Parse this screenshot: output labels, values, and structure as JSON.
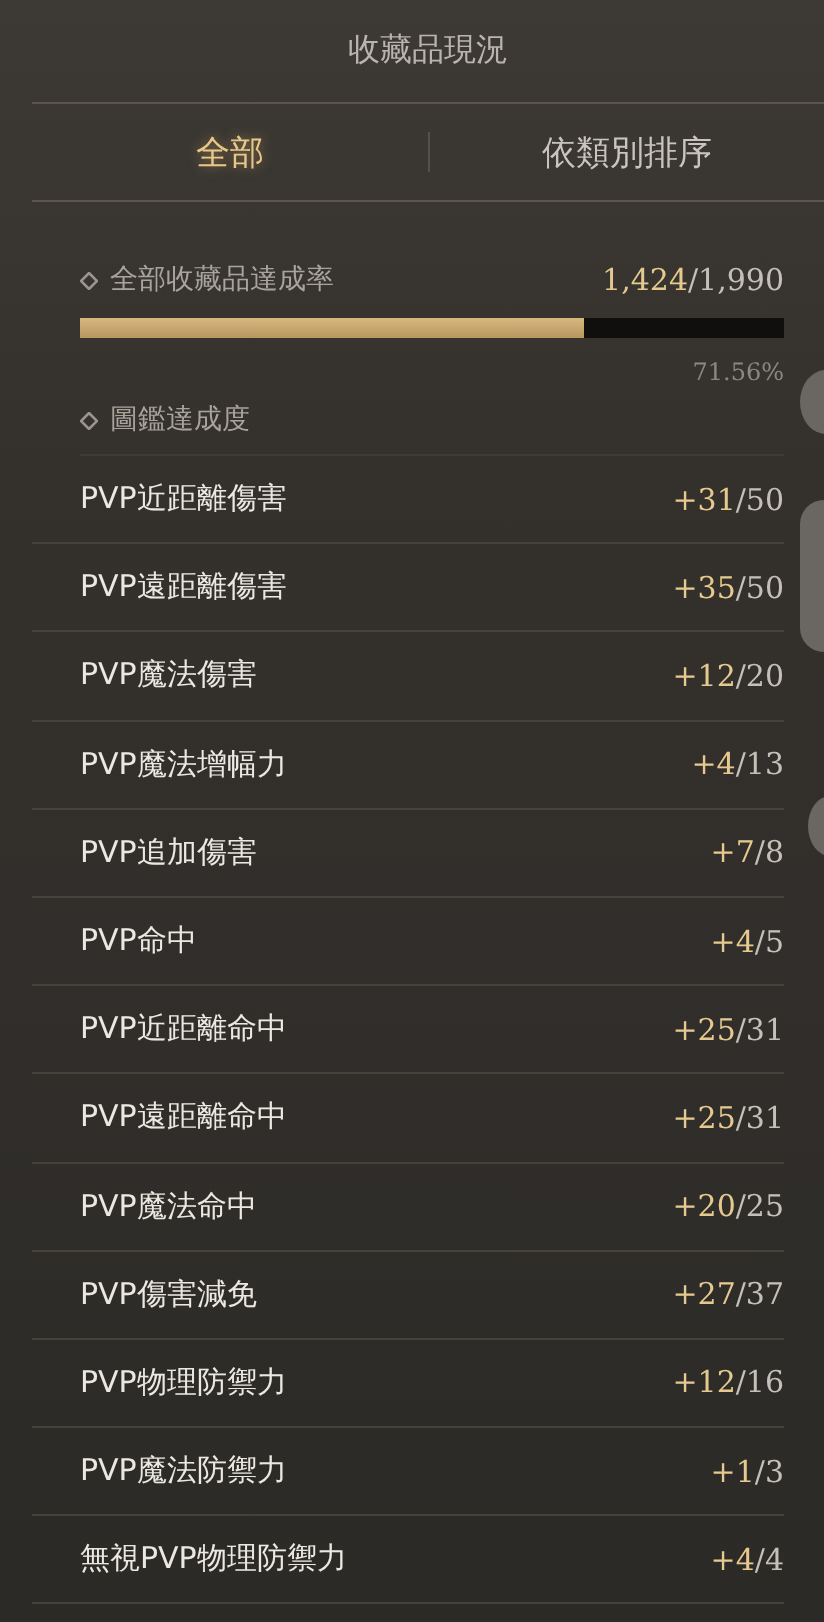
{
  "header": {
    "title": "收藏品現況"
  },
  "tabs": [
    {
      "label": "全部",
      "selected": true
    },
    {
      "label": "依類別排序",
      "selected": false
    }
  ],
  "overall": {
    "label": "全部收藏品達成率",
    "achieved": "1,424",
    "total": "/1,990",
    "level": 0.7156,
    "percent": "71.56%"
  },
  "codex": {
    "label": "圖鑑達成度"
  },
  "stats": [
    {
      "name": "PVP近距離傷害",
      "bonus": "+31",
      "max": "/50"
    },
    {
      "name": "PVP遠距離傷害",
      "bonus": "+35",
      "max": "/50"
    },
    {
      "name": "PVP魔法傷害",
      "bonus": "+12",
      "max": "/20"
    },
    {
      "name": "PVP魔法增幅力",
      "bonus": "+4",
      "max": "/13"
    },
    {
      "name": "PVP追加傷害",
      "bonus": "+7",
      "max": "/8"
    },
    {
      "name": "PVP命中",
      "bonus": "+4",
      "max": "/5"
    },
    {
      "name": "PVP近距離命中",
      "bonus": "+25",
      "max": "/31"
    },
    {
      "name": "PVP遠距離命中",
      "bonus": "+25",
      "max": "/31"
    },
    {
      "name": "PVP魔法命中",
      "bonus": "+20",
      "max": "/25"
    },
    {
      "name": "PVP傷害減免",
      "bonus": "+27",
      "max": "/37"
    },
    {
      "name": "PVP物理防禦力",
      "bonus": "+12",
      "max": "/16"
    },
    {
      "name": "PVP魔法防禦力",
      "bonus": "+1",
      "max": "/3"
    },
    {
      "name": "無視PVP物理防禦力",
      "bonus": "+4",
      "max": "/4"
    }
  ]
}
